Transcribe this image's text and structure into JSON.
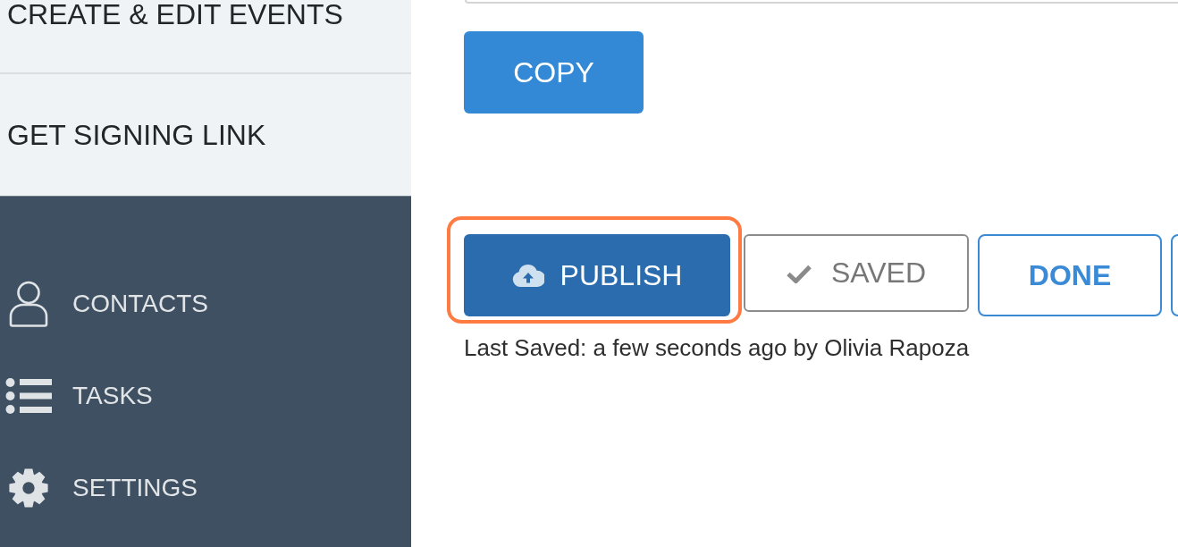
{
  "sidebar": {
    "steps": [
      {
        "label": "CREATE & EDIT EVENTS"
      },
      {
        "label": "GET SIGNING LINK"
      }
    ],
    "menu": [
      {
        "label": "CONTACTS"
      },
      {
        "label": "TASKS"
      },
      {
        "label": "SETTINGS"
      }
    ]
  },
  "main": {
    "copy_button": {
      "label": "COPY"
    },
    "actions": [
      {
        "kind": "primary",
        "label": "PUBLISH",
        "highlighted": true
      },
      {
        "kind": "status",
        "label": "SAVED",
        "highlighted": false
      },
      {
        "kind": "outline",
        "label": "DONE",
        "highlighted": false
      },
      {
        "kind": "outline",
        "highlighted": false
      }
    ],
    "last_saved": "Last Saved: a few seconds ago by Olivia Rapoza"
  }
}
